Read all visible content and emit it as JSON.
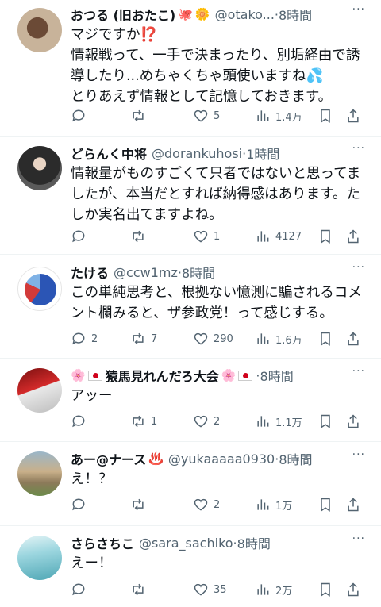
{
  "tweets": [
    {
      "name": "おつる (旧おたこ)",
      "name_emojis": [
        "🐙",
        "🌼"
      ],
      "handle": "@otako...",
      "time": "8時間",
      "text": "マジですか⁉️\n情報戦って、一手で決まったり、別垢経由で誘導したり...めちゃくちゃ頭使いますね💦\nとりあえず情報として記憶しておきます。",
      "replies": "",
      "retweets": "",
      "likes": "5",
      "views": "1.4万"
    },
    {
      "name": "どらんく中将",
      "name_emojis": [],
      "handle": "@dorankuhosi",
      "time": "1時間",
      "text": "情報量がものすごくて只者ではないと思ってましたが、本当だとすれば納得感はあります。たしか実名出てますよね。",
      "replies": "",
      "retweets": "",
      "likes": "1",
      "views": "4127"
    },
    {
      "name": "たける",
      "name_emojis": [],
      "handle": "@ccw1mz",
      "time": "8時間",
      "text": "この単純思考と、根拠ない憶測に騙されるコメント欄みると、ザ参政党！って感じする。",
      "replies": "2",
      "retweets": "7",
      "likes": "290",
      "views": "1.6万"
    },
    {
      "name": "猿馬見れんだろ大会",
      "name_emojis": [
        "🌸",
        "🇯🇵"
      ],
      "name_emojis_after": [
        "🌸",
        "🇯🇵"
      ],
      "handle": "",
      "time": "8時間",
      "text": "アッー",
      "replies": "",
      "retweets": "1",
      "likes": "2",
      "views": "1.1万"
    },
    {
      "name": "あー@ナース",
      "name_emojis": [
        "♨️"
      ],
      "handle": "@yukaaaaa0930",
      "time": "8時間",
      "text": "え！？",
      "replies": "",
      "retweets": "",
      "likes": "2",
      "views": "1万"
    },
    {
      "name": "さらさちこ",
      "name_emojis": [],
      "handle": "@sara_sachiko",
      "time": "8時間",
      "text": "えー！",
      "replies": "",
      "retweets": "",
      "likes": "35",
      "views": "2万"
    }
  ],
  "dot": "·",
  "more_label": "···",
  "icons": {
    "reply": "reply-icon",
    "retweet": "retweet-icon",
    "like": "heart-icon",
    "views": "views-icon",
    "bookmark": "bookmark-icon",
    "share": "share-icon"
  }
}
